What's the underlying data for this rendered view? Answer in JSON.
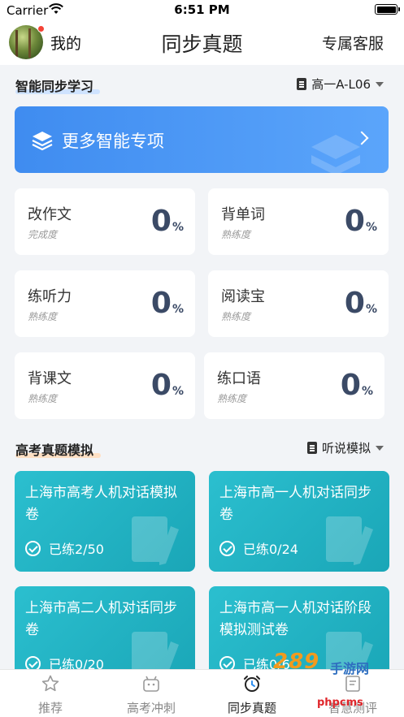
{
  "status_bar": {
    "carrier": "Carrier",
    "time": "6:51 PM"
  },
  "nav": {
    "me_label": "我的",
    "title": "同步真题",
    "service_label": "专属客服"
  },
  "smart_section": {
    "title": "智能同步学习",
    "level": "高一A-L06"
  },
  "banner": {
    "label": "更多智能专项"
  },
  "skills": [
    {
      "name": "改作文",
      "sub": "完成度",
      "value": "0",
      "unit": "%"
    },
    {
      "name": "背单词",
      "sub": "熟练度",
      "value": "0",
      "unit": "%"
    },
    {
      "name": "练听力",
      "sub": "熟练度",
      "value": "0",
      "unit": "%"
    },
    {
      "name": "阅读宝",
      "sub": "熟练度",
      "value": "0",
      "unit": "%"
    },
    {
      "name": "背课文",
      "sub": "熟练度",
      "value": "0",
      "unit": "%"
    },
    {
      "name": "练口语",
      "sub": "熟练度",
      "value": "0",
      "unit": "%"
    }
  ],
  "exam_section": {
    "title": "高考真题模拟",
    "filter": "听说模拟"
  },
  "exams": [
    {
      "name": "上海市高考人机对话模拟卷",
      "progress": "已练2/50"
    },
    {
      "name": "上海市高一人机对话同步卷",
      "progress": "已练0/24"
    },
    {
      "name": "上海市高二人机对话同步卷",
      "progress": "已练0/20"
    },
    {
      "name": "上海市高一人机对话阶段模拟测试卷",
      "progress": "已练0/6"
    }
  ],
  "tabbar": {
    "tabs": [
      {
        "label": "推荐",
        "icon": "star-icon"
      },
      {
        "label": "高考冲刺",
        "icon": "robot-icon"
      },
      {
        "label": "同步真题",
        "icon": "alarm-clock-icon"
      },
      {
        "label": "智慧测评",
        "icon": "evaluate-icon"
      }
    ],
    "active_index": 2
  },
  "watermark": {
    "line1": "289",
    "line2": "手游网",
    "line3": "phpcms"
  },
  "colors": {
    "accent_blue": "#3f8cf0",
    "card_teal": "#1fb2c3",
    "percent_text": "#3b4a66"
  }
}
